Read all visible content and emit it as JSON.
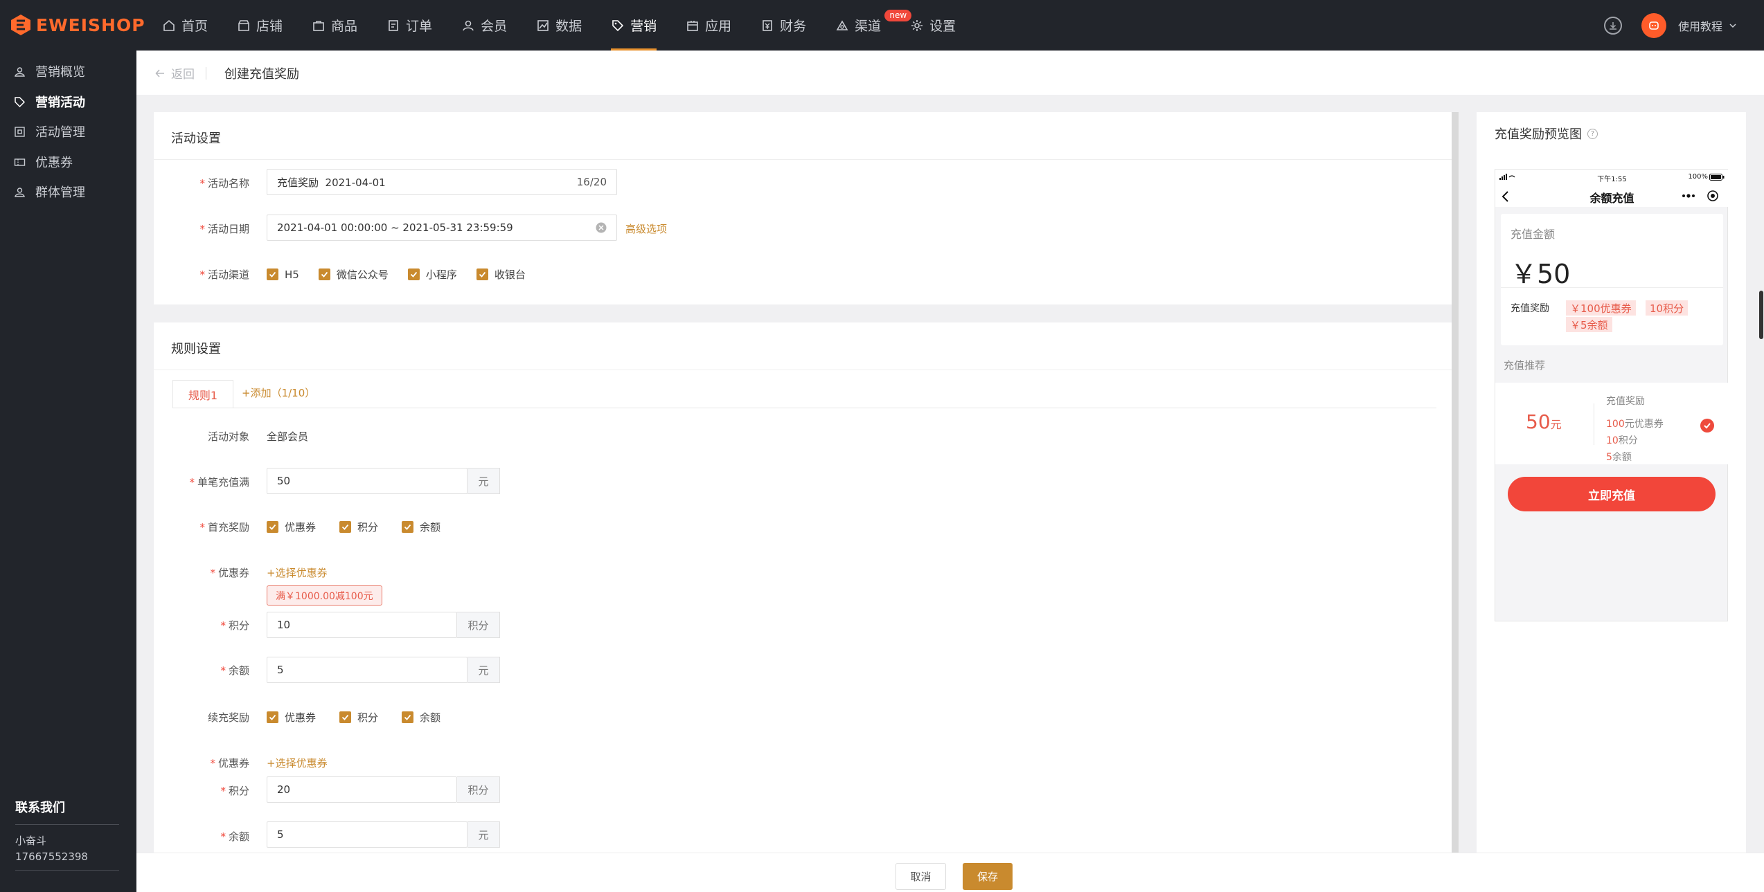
{
  "brand": {
    "name": "EWEISHOP",
    "accent": "#ff6a2c"
  },
  "top_nav": {
    "items": [
      {
        "label": "首页",
        "icon": "home-icon"
      },
      {
        "label": "店铺",
        "icon": "shop-icon"
      },
      {
        "label": "商品",
        "icon": "goods-icon"
      },
      {
        "label": "订单",
        "icon": "order-icon"
      },
      {
        "label": "会员",
        "icon": "member-icon"
      },
      {
        "label": "数据",
        "icon": "chart-icon"
      },
      {
        "label": "营销",
        "icon": "tag-icon"
      },
      {
        "label": "应用",
        "icon": "app-icon"
      },
      {
        "label": "财务",
        "icon": "finance-icon"
      },
      {
        "label": "渠道",
        "icon": "channel-icon"
      },
      {
        "label": "设置",
        "icon": "gear-icon"
      }
    ],
    "active": "营销",
    "new_badge": "new",
    "help": "使用教程"
  },
  "sidebar": {
    "items": [
      {
        "label": "营销概览"
      },
      {
        "label": "营销活动"
      },
      {
        "label": "活动管理"
      },
      {
        "label": "优惠券"
      },
      {
        "label": "群体管理"
      }
    ],
    "active": "营销活动",
    "contact": {
      "title": "联系我们",
      "name": "小奋斗",
      "phone": "17667552398"
    }
  },
  "header": {
    "back": "返回",
    "title": "创建充值奖励"
  },
  "activity": {
    "title": "活动设置",
    "name_label": "活动名称",
    "name_value": "充值奖励  2021-04-01",
    "name_count": "16/20",
    "date_label": "活动日期",
    "date_value": "2021-04-01 00:00:00 ~ 2021-05-31 23:59:59",
    "advanced": "高级选项",
    "channel_label": "活动渠道",
    "channels": [
      "H5",
      "微信公众号",
      "小程序",
      "收银台"
    ]
  },
  "rules": {
    "title": "规则设置",
    "tab": "规则1",
    "add": "+添加（1/10）",
    "target_label": "活动对象",
    "target_value": "全部会员",
    "single_label": "单笔充值满",
    "single_value": "50",
    "single_unit": "元",
    "first_label": "首充奖励",
    "options": [
      "优惠券",
      "积分",
      "余额"
    ],
    "coupon_label": "优惠券",
    "coupon_link": "+选择优惠券",
    "coupon_tag": "满￥1000.00减100元",
    "points_label": "积分",
    "points_unit": "积分",
    "first_points": "10",
    "balance_label": "余额",
    "balance_unit": "元",
    "first_balance": "5",
    "renew_label": "续充奖励",
    "renew_points": "20",
    "renew_balance": "5"
  },
  "footer": {
    "cancel": "取消",
    "save": "保存"
  },
  "preview": {
    "title": "充值奖励预览图",
    "status_time": "下午1:55",
    "battery": "100%",
    "nav_title": "余额充值",
    "amount_label": "充值金额",
    "amount_value": "￥50",
    "reward_label": "充值奖励",
    "reward_tags": [
      "￥100优惠券",
      "10积分",
      "￥5余额"
    ],
    "recommend_label": "充值推荐",
    "rec_amount": "50",
    "rec_unit": "元",
    "rec_title": "充值奖励",
    "rec_lines": [
      {
        "num": "100",
        "text": "元优惠券"
      },
      {
        "num": "10",
        "text": "积分"
      },
      {
        "num": "5",
        "text": "余额"
      }
    ],
    "charge_btn": "立即充值"
  }
}
